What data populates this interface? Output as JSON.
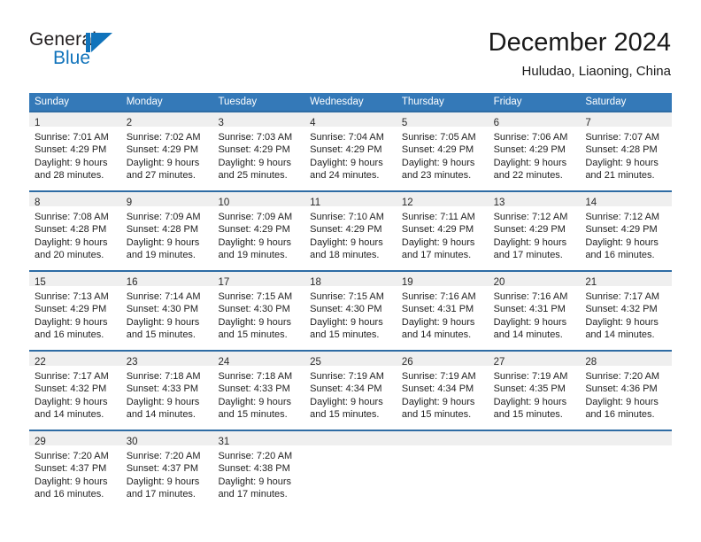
{
  "brand": {
    "word_one": "General",
    "word_two": "Blue",
    "mark": "triangle-logo"
  },
  "header": {
    "title": "December 2024",
    "subtitle": "Huludao, Liaoning, China"
  },
  "calendar": {
    "weekday_headers": [
      "Sunday",
      "Monday",
      "Tuesday",
      "Wednesday",
      "Thursday",
      "Friday",
      "Saturday"
    ],
    "colors": {
      "header_blue": "#3479b8",
      "row_rule_blue": "#2e6ca4",
      "day_band_gray": "#efefef",
      "brand_blue": "#1073bb"
    },
    "weeks": [
      [
        {
          "day": "1",
          "sunrise": "Sunrise: 7:01 AM",
          "sunset": "Sunset: 4:29 PM",
          "daylight_1": "Daylight: 9 hours",
          "daylight_2": "and 28 minutes."
        },
        {
          "day": "2",
          "sunrise": "Sunrise: 7:02 AM",
          "sunset": "Sunset: 4:29 PM",
          "daylight_1": "Daylight: 9 hours",
          "daylight_2": "and 27 minutes."
        },
        {
          "day": "3",
          "sunrise": "Sunrise: 7:03 AM",
          "sunset": "Sunset: 4:29 PM",
          "daylight_1": "Daylight: 9 hours",
          "daylight_2": "and 25 minutes."
        },
        {
          "day": "4",
          "sunrise": "Sunrise: 7:04 AM",
          "sunset": "Sunset: 4:29 PM",
          "daylight_1": "Daylight: 9 hours",
          "daylight_2": "and 24 minutes."
        },
        {
          "day": "5",
          "sunrise": "Sunrise: 7:05 AM",
          "sunset": "Sunset: 4:29 PM",
          "daylight_1": "Daylight: 9 hours",
          "daylight_2": "and 23 minutes."
        },
        {
          "day": "6",
          "sunrise": "Sunrise: 7:06 AM",
          "sunset": "Sunset: 4:29 PM",
          "daylight_1": "Daylight: 9 hours",
          "daylight_2": "and 22 minutes."
        },
        {
          "day": "7",
          "sunrise": "Sunrise: 7:07 AM",
          "sunset": "Sunset: 4:28 PM",
          "daylight_1": "Daylight: 9 hours",
          "daylight_2": "and 21 minutes."
        }
      ],
      [
        {
          "day": "8",
          "sunrise": "Sunrise: 7:08 AM",
          "sunset": "Sunset: 4:28 PM",
          "daylight_1": "Daylight: 9 hours",
          "daylight_2": "and 20 minutes."
        },
        {
          "day": "9",
          "sunrise": "Sunrise: 7:09 AM",
          "sunset": "Sunset: 4:28 PM",
          "daylight_1": "Daylight: 9 hours",
          "daylight_2": "and 19 minutes."
        },
        {
          "day": "10",
          "sunrise": "Sunrise: 7:09 AM",
          "sunset": "Sunset: 4:29 PM",
          "daylight_1": "Daylight: 9 hours",
          "daylight_2": "and 19 minutes."
        },
        {
          "day": "11",
          "sunrise": "Sunrise: 7:10 AM",
          "sunset": "Sunset: 4:29 PM",
          "daylight_1": "Daylight: 9 hours",
          "daylight_2": "and 18 minutes."
        },
        {
          "day": "12",
          "sunrise": "Sunrise: 7:11 AM",
          "sunset": "Sunset: 4:29 PM",
          "daylight_1": "Daylight: 9 hours",
          "daylight_2": "and 17 minutes."
        },
        {
          "day": "13",
          "sunrise": "Sunrise: 7:12 AM",
          "sunset": "Sunset: 4:29 PM",
          "daylight_1": "Daylight: 9 hours",
          "daylight_2": "and 17 minutes."
        },
        {
          "day": "14",
          "sunrise": "Sunrise: 7:12 AM",
          "sunset": "Sunset: 4:29 PM",
          "daylight_1": "Daylight: 9 hours",
          "daylight_2": "and 16 minutes."
        }
      ],
      [
        {
          "day": "15",
          "sunrise": "Sunrise: 7:13 AM",
          "sunset": "Sunset: 4:29 PM",
          "daylight_1": "Daylight: 9 hours",
          "daylight_2": "and 16 minutes."
        },
        {
          "day": "16",
          "sunrise": "Sunrise: 7:14 AM",
          "sunset": "Sunset: 4:30 PM",
          "daylight_1": "Daylight: 9 hours",
          "daylight_2": "and 15 minutes."
        },
        {
          "day": "17",
          "sunrise": "Sunrise: 7:15 AM",
          "sunset": "Sunset: 4:30 PM",
          "daylight_1": "Daylight: 9 hours",
          "daylight_2": "and 15 minutes."
        },
        {
          "day": "18",
          "sunrise": "Sunrise: 7:15 AM",
          "sunset": "Sunset: 4:30 PM",
          "daylight_1": "Daylight: 9 hours",
          "daylight_2": "and 15 minutes."
        },
        {
          "day": "19",
          "sunrise": "Sunrise: 7:16 AM",
          "sunset": "Sunset: 4:31 PM",
          "daylight_1": "Daylight: 9 hours",
          "daylight_2": "and 14 minutes."
        },
        {
          "day": "20",
          "sunrise": "Sunrise: 7:16 AM",
          "sunset": "Sunset: 4:31 PM",
          "daylight_1": "Daylight: 9 hours",
          "daylight_2": "and 14 minutes."
        },
        {
          "day": "21",
          "sunrise": "Sunrise: 7:17 AM",
          "sunset": "Sunset: 4:32 PM",
          "daylight_1": "Daylight: 9 hours",
          "daylight_2": "and 14 minutes."
        }
      ],
      [
        {
          "day": "22",
          "sunrise": "Sunrise: 7:17 AM",
          "sunset": "Sunset: 4:32 PM",
          "daylight_1": "Daylight: 9 hours",
          "daylight_2": "and 14 minutes."
        },
        {
          "day": "23",
          "sunrise": "Sunrise: 7:18 AM",
          "sunset": "Sunset: 4:33 PM",
          "daylight_1": "Daylight: 9 hours",
          "daylight_2": "and 14 minutes."
        },
        {
          "day": "24",
          "sunrise": "Sunrise: 7:18 AM",
          "sunset": "Sunset: 4:33 PM",
          "daylight_1": "Daylight: 9 hours",
          "daylight_2": "and 15 minutes."
        },
        {
          "day": "25",
          "sunrise": "Sunrise: 7:19 AM",
          "sunset": "Sunset: 4:34 PM",
          "daylight_1": "Daylight: 9 hours",
          "daylight_2": "and 15 minutes."
        },
        {
          "day": "26",
          "sunrise": "Sunrise: 7:19 AM",
          "sunset": "Sunset: 4:34 PM",
          "daylight_1": "Daylight: 9 hours",
          "daylight_2": "and 15 minutes."
        },
        {
          "day": "27",
          "sunrise": "Sunrise: 7:19 AM",
          "sunset": "Sunset: 4:35 PM",
          "daylight_1": "Daylight: 9 hours",
          "daylight_2": "and 15 minutes."
        },
        {
          "day": "28",
          "sunrise": "Sunrise: 7:20 AM",
          "sunset": "Sunset: 4:36 PM",
          "daylight_1": "Daylight: 9 hours",
          "daylight_2": "and 16 minutes."
        }
      ],
      [
        {
          "day": "29",
          "sunrise": "Sunrise: 7:20 AM",
          "sunset": "Sunset: 4:37 PM",
          "daylight_1": "Daylight: 9 hours",
          "daylight_2": "and 16 minutes."
        },
        {
          "day": "30",
          "sunrise": "Sunrise: 7:20 AM",
          "sunset": "Sunset: 4:37 PM",
          "daylight_1": "Daylight: 9 hours",
          "daylight_2": "and 17 minutes."
        },
        {
          "day": "31",
          "sunrise": "Sunrise: 7:20 AM",
          "sunset": "Sunset: 4:38 PM",
          "daylight_1": "Daylight: 9 hours",
          "daylight_2": "and 17 minutes."
        },
        {
          "day": "",
          "sunrise": "",
          "sunset": "",
          "daylight_1": "",
          "daylight_2": ""
        },
        {
          "day": "",
          "sunrise": "",
          "sunset": "",
          "daylight_1": "",
          "daylight_2": ""
        },
        {
          "day": "",
          "sunrise": "",
          "sunset": "",
          "daylight_1": "",
          "daylight_2": ""
        },
        {
          "day": "",
          "sunrise": "",
          "sunset": "",
          "daylight_1": "",
          "daylight_2": ""
        }
      ]
    ]
  }
}
